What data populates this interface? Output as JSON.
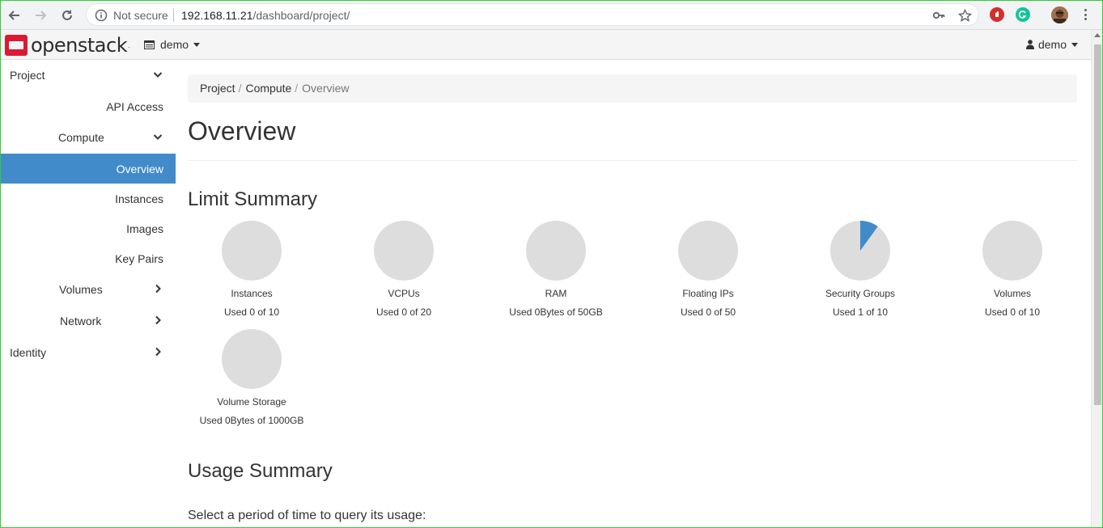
{
  "browser": {
    "security_label": "Not secure",
    "url_host": "192.168.11.21",
    "url_path": "/dashboard/project/",
    "colors": {
      "chrome_bg": "#f1f3f4",
      "ext_red": "#d32f2f",
      "ext_green": "#15c39a"
    }
  },
  "topnav": {
    "brand": "openstack",
    "brand_mark": ".",
    "project_label": "demo",
    "user_label": "demo"
  },
  "sidebar": {
    "items": [
      {
        "label": "Project",
        "chevron": "chevron-down"
      },
      {
        "label": "API Access"
      },
      {
        "label": "Compute",
        "chevron": "chevron-down"
      },
      {
        "label": "Overview",
        "active": true
      },
      {
        "label": "Instances"
      },
      {
        "label": "Images"
      },
      {
        "label": "Key Pairs"
      },
      {
        "label": "Volumes",
        "chevron": "chevron-right"
      },
      {
        "label": "Network",
        "chevron": "chevron-right"
      },
      {
        "label": "Identity",
        "chevron": "chevron-right"
      }
    ],
    "active_color": "#428bca"
  },
  "breadcrumb": {
    "items": [
      "Project",
      "Compute",
      "Overview"
    ],
    "separator": "/"
  },
  "page": {
    "title": "Overview",
    "limit_heading": "Limit Summary",
    "usage_heading": "Usage Summary",
    "query_text": "Select a period of time to query its usage:"
  },
  "limits": [
    {
      "name": "Instances",
      "usage": "Used 0 of 10",
      "used": 0,
      "total": 10
    },
    {
      "name": "VCPUs",
      "usage": "Used 0 of 20",
      "used": 0,
      "total": 20
    },
    {
      "name": "RAM",
      "usage": "Used 0Bytes of 50GB",
      "used": 0,
      "total": 50
    },
    {
      "name": "Floating IPs",
      "usage": "Used 0 of 50",
      "used": 0,
      "total": 50
    },
    {
      "name": "Security Groups",
      "usage": "Used 1 of 10",
      "used": 1,
      "total": 10
    },
    {
      "name": "Volumes",
      "usage": "Used 0 of 10",
      "used": 0,
      "total": 10
    },
    {
      "name": "Volume Storage",
      "usage": "Used 0Bytes of 1000GB",
      "used": 0,
      "total": 1000
    }
  ],
  "pie_colors": {
    "empty": "#dddddd",
    "used": "#428bca"
  }
}
